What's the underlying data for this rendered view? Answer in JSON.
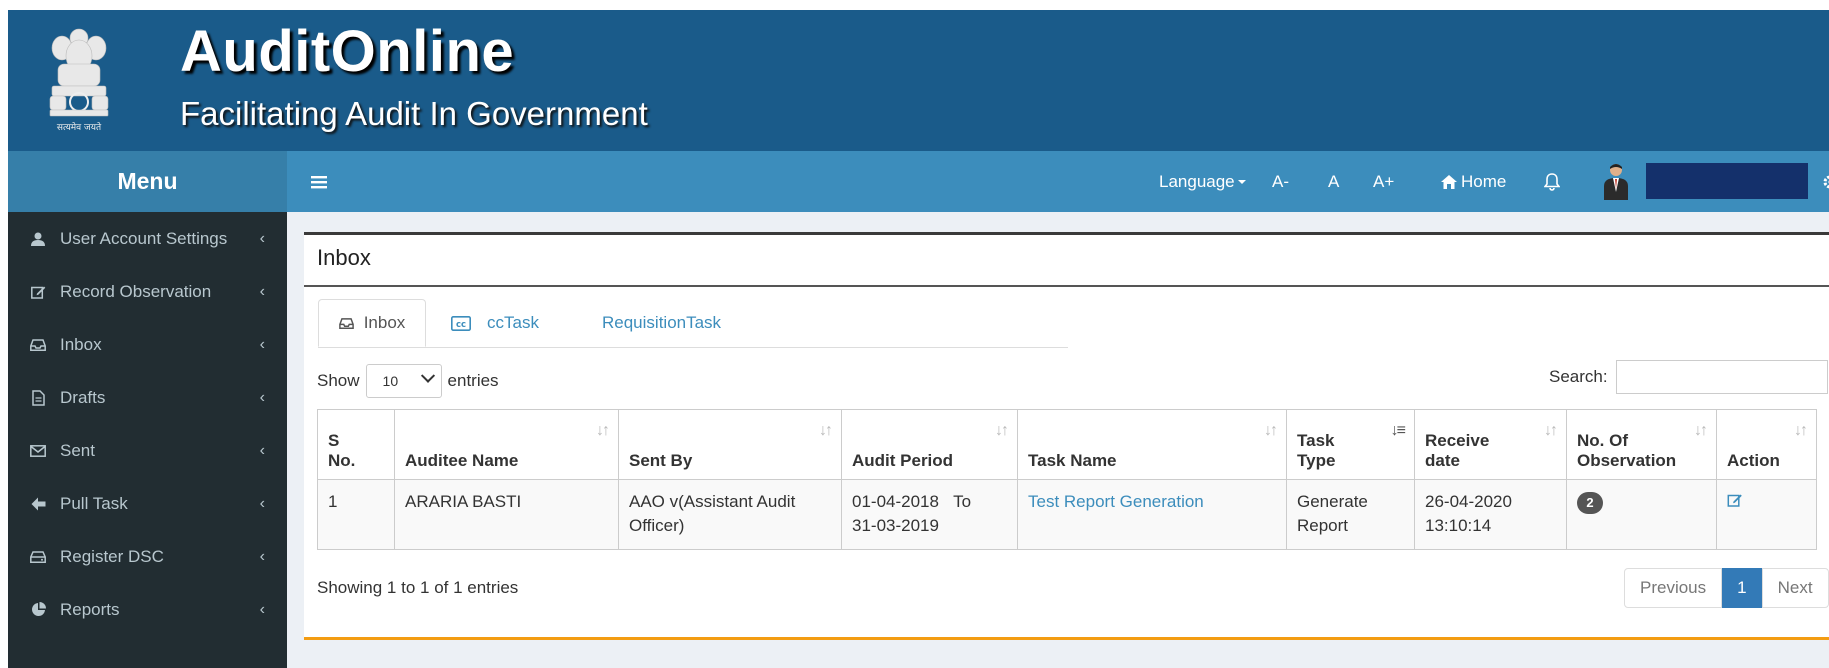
{
  "header": {
    "brand": "AuditOnline",
    "tagline": "Facilitating Audit In Government",
    "emblem_motto": "सत्यमेव जयते"
  },
  "menu": {
    "title": "Menu"
  },
  "topnav": {
    "language": "Language",
    "font_small": "A-",
    "font_normal": "A",
    "font_large": "A+",
    "home": "Home"
  },
  "sidebar": {
    "items": [
      {
        "label": "User Account Settings",
        "icon": "user-icon"
      },
      {
        "label": "Record Observation",
        "icon": "edit-icon"
      },
      {
        "label": "Inbox",
        "icon": "inbox-icon"
      },
      {
        "label": "Drafts",
        "icon": "file-icon"
      },
      {
        "label": "Sent",
        "icon": "envelope-icon"
      },
      {
        "label": "Pull Task",
        "icon": "arrow-left-icon"
      },
      {
        "label": "Register DSC",
        "icon": "hdd-icon"
      },
      {
        "label": "Reports",
        "icon": "pie-chart-icon"
      }
    ]
  },
  "box": {
    "title": "Inbox"
  },
  "tabs": [
    {
      "label": "Inbox",
      "active": true
    },
    {
      "label": "ccTask",
      "active": false
    },
    {
      "label": "RequisitionTask",
      "active": false
    }
  ],
  "length": {
    "show": "Show",
    "value": "10",
    "entries": "entries"
  },
  "search": {
    "label": "Search:",
    "value": ""
  },
  "table": {
    "headers": [
      {
        "line1": "S",
        "line2": "No."
      },
      {
        "line1": "",
        "line2": "Auditee Name"
      },
      {
        "line1": "",
        "line2": "Sent By"
      },
      {
        "line1": "",
        "line2": "Audit Period"
      },
      {
        "line1": "",
        "line2": "Task Name"
      },
      {
        "line1": "Task",
        "line2": "Type"
      },
      {
        "line1": "Receive",
        "line2": "date"
      },
      {
        "line1": "No. Of",
        "line2": "Observation"
      },
      {
        "line1": "",
        "line2": "Action"
      }
    ],
    "rows": [
      {
        "sno": "1",
        "auditee": "ARARIA BASTI",
        "sent_by": "AAO v(Assistant Audit Officer)",
        "period_from": "01-04-2018",
        "period_to_word": "To",
        "period_to": "31-03-2019",
        "task_name": "Test Report Generation",
        "task_type": "Generate Report",
        "receive_date": "26-04-2020",
        "receive_time": "13:10:14",
        "observations": "2"
      }
    ]
  },
  "footer": {
    "info": "Showing 1 to 1 of 1 entries",
    "previous": "Previous",
    "page": "1",
    "next": "Next"
  },
  "colors": {
    "banner": "#1a5b8a",
    "navbar": "#3c8dbc",
    "menu_header": "#367fa9",
    "sidebar": "#222d32",
    "accent": "#f39c12"
  }
}
